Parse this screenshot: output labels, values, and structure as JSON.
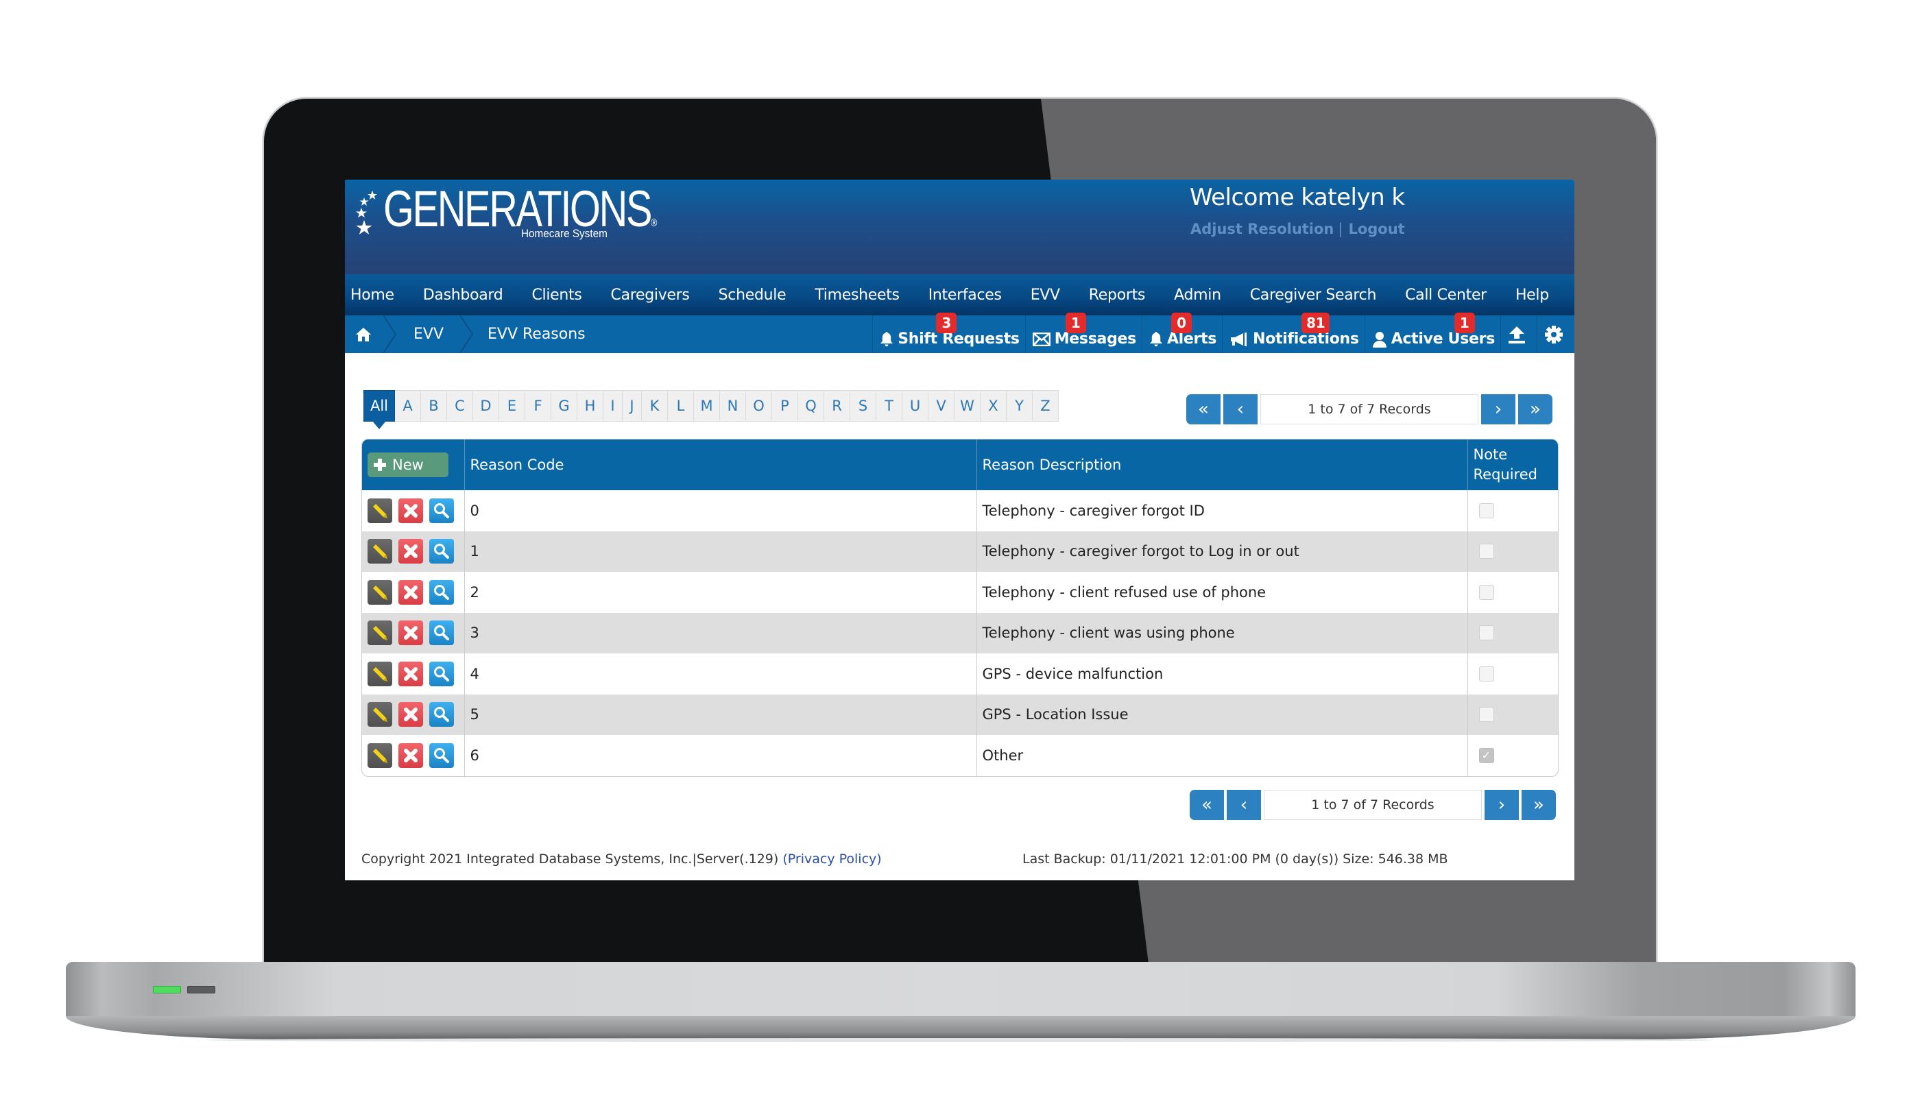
{
  "app": {
    "brand": "GENERATIONS",
    "brand_mark": "®",
    "tagline": "Homecare System",
    "welcome": "Welcome katelyn k",
    "user_links": [
      "Adjust Resolution",
      "Logout"
    ],
    "user_links_separator": "|"
  },
  "nav": [
    "Home",
    "Dashboard",
    "Clients",
    "Caregivers",
    "Schedule",
    "Timesheets",
    "Interfaces",
    "EVV",
    "Reports",
    "Admin",
    "Caregiver Search",
    "Call Center",
    "Help"
  ],
  "breadcrumb": {
    "home_icon": "home-icon",
    "items": [
      "EVV",
      "EVV Reasons"
    ]
  },
  "toolbar": [
    {
      "label": "Shift Requests",
      "icon": "bell-icon",
      "badge": "3"
    },
    {
      "label": "Messages",
      "icon": "envelope-icon",
      "badge": "1"
    },
    {
      "label": "Alerts",
      "icon": "bell-icon",
      "badge": "0"
    },
    {
      "label": "Notifications",
      "icon": "megaphone-icon",
      "badge": "81"
    },
    {
      "label": "Active Users",
      "icon": "user-icon",
      "badge": "1"
    }
  ],
  "toolbar_icons": [
    "upload-icon",
    "gear-icon"
  ],
  "alphabet": [
    "All",
    "A",
    "B",
    "C",
    "D",
    "E",
    "F",
    "G",
    "H",
    "I",
    "J",
    "K",
    "L",
    "M",
    "N",
    "O",
    "P",
    "Q",
    "R",
    "S",
    "T",
    "U",
    "V",
    "W",
    "X",
    "Y",
    "Z"
  ],
  "alphabet_active": "All",
  "pager": {
    "first": "«",
    "prev": "‹",
    "next": "›",
    "last": "»",
    "info": "1 to 7 of 7 Records"
  },
  "table": {
    "new_label": "New",
    "columns": [
      "Reason Code",
      "Reason Description",
      "Note Required"
    ],
    "rows": [
      {
        "code": "0",
        "description": "Telephony - caregiver forgot ID",
        "note_required": false
      },
      {
        "code": "1",
        "description": "Telephony - caregiver forgot to Log in or out",
        "note_required": false
      },
      {
        "code": "2",
        "description": "Telephony - client refused use of phone",
        "note_required": false
      },
      {
        "code": "3",
        "description": "Telephony - client was using phone",
        "note_required": false
      },
      {
        "code": "4",
        "description": "GPS - device malfunction",
        "note_required": false
      },
      {
        "code": "5",
        "description": "GPS - Location Issue",
        "note_required": false
      },
      {
        "code": "6",
        "description": "Other",
        "note_required": true
      }
    ]
  },
  "footer": {
    "copyright": "Copyright 2021 Integrated Database Systems, Inc.|Server(.129) ",
    "privacy": "(Privacy Policy)",
    "backup": "Last Backup: 01/11/2021 12:01:00 PM (0 day(s)) Size: 546.38 MB"
  },
  "colors": {
    "brand_blue": "#0966a5",
    "badge_red": "#e32b2b",
    "new_green": "#5a9a7c"
  }
}
